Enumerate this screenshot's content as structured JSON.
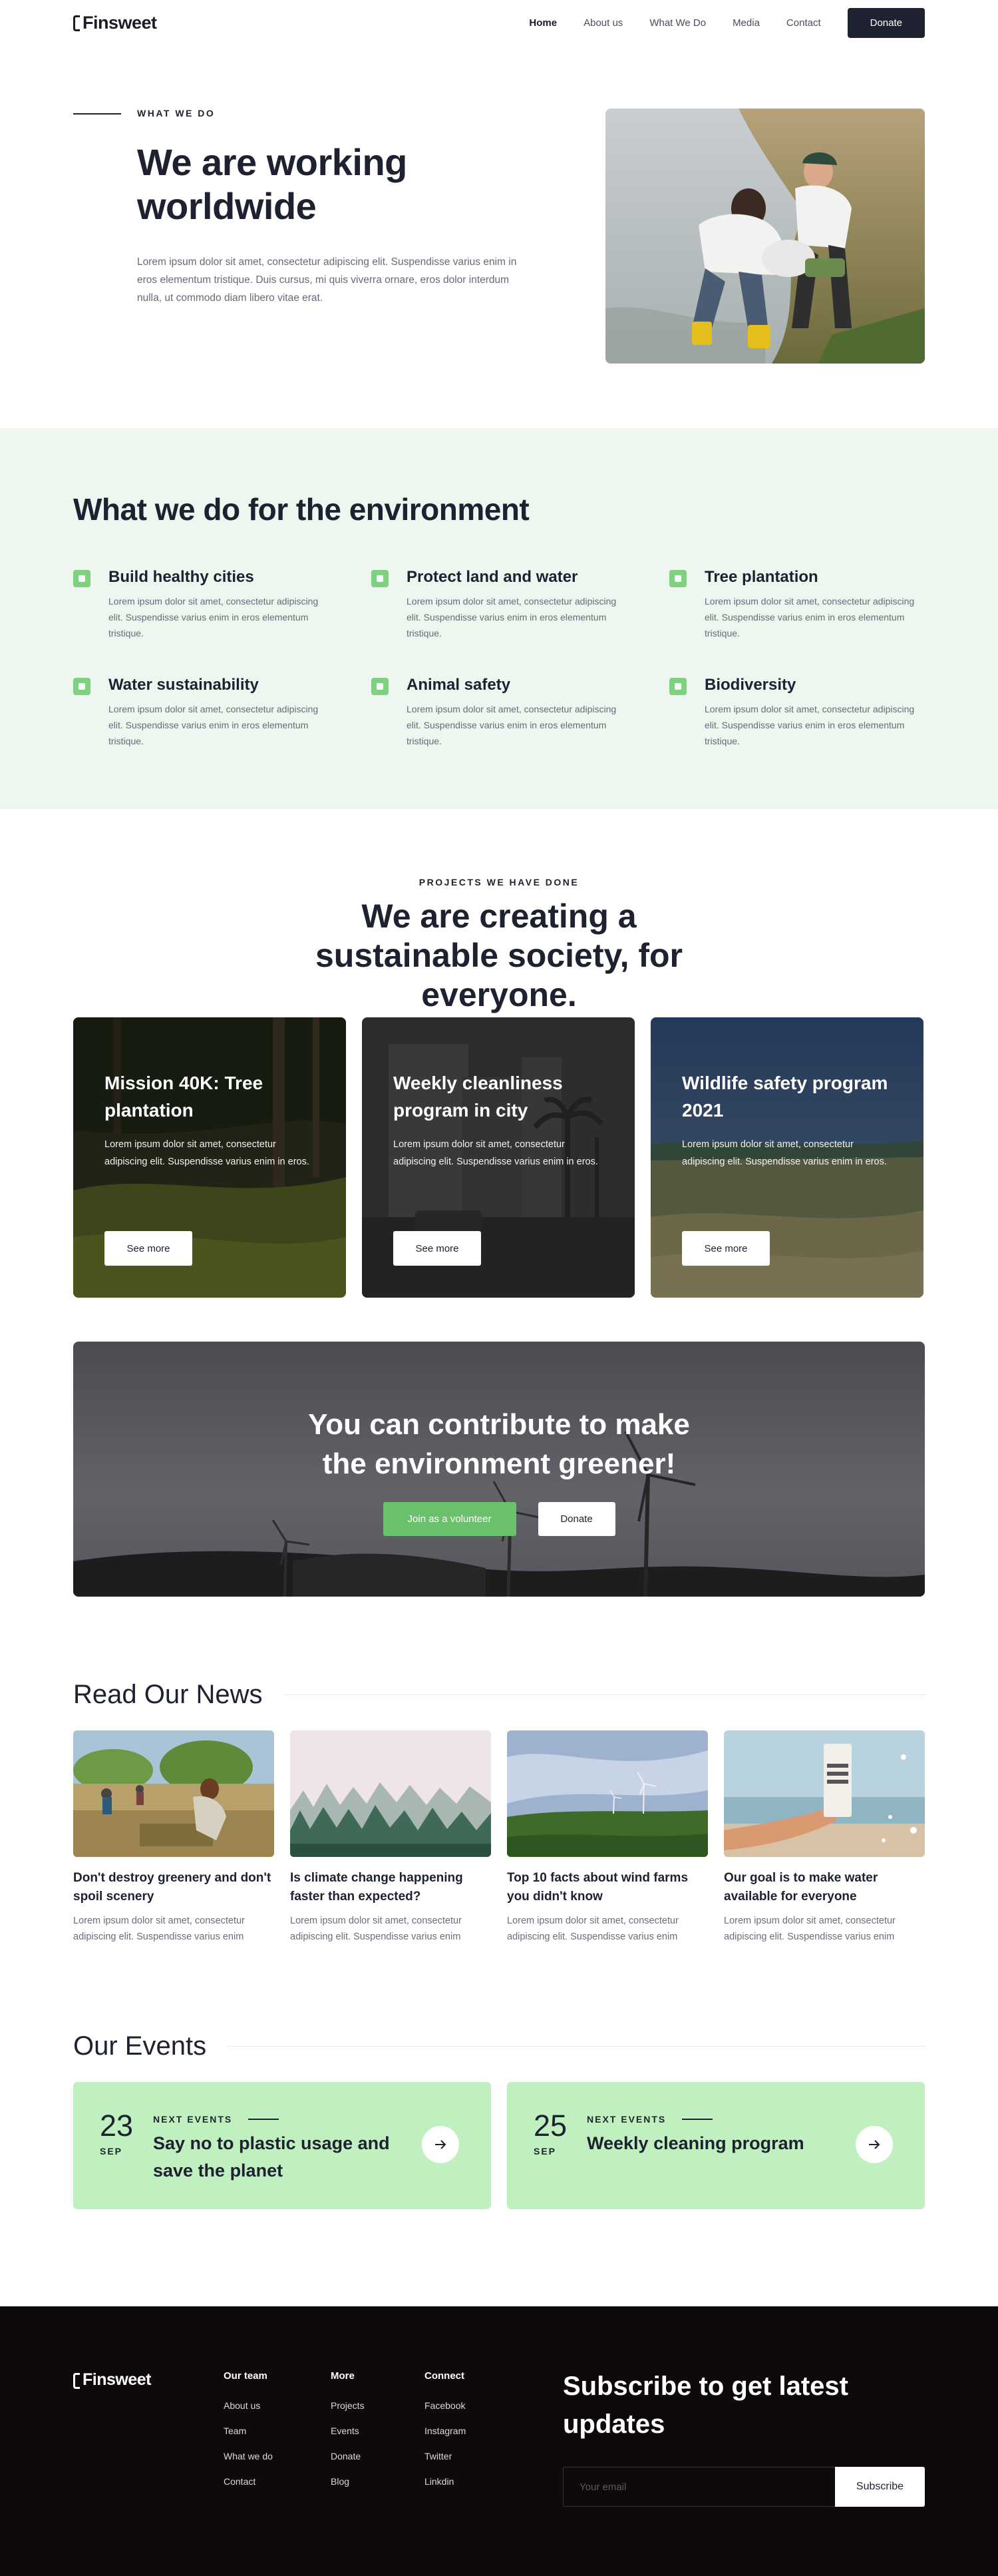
{
  "nav": {
    "logo": "Finsweet",
    "links": [
      "Home",
      "About us",
      "What We Do",
      "Media",
      "Contact"
    ],
    "active_index": 0,
    "donate_label": "Donate"
  },
  "hero": {
    "eyebrow": "WHAT WE DO",
    "title": "We are working worldwide",
    "text": "Lorem ipsum dolor sit amet, consectetur adipiscing elit. Suspendisse varius enim in eros elementum tristique. Duis cursus, mi quis viverra ornare, eros dolor interdum nulla, ut commodo diam libero vitae erat."
  },
  "environment": {
    "title": "What we do for the environment",
    "items": [
      {
        "title": "Build healthy cities",
        "text": "Lorem ipsum dolor sit amet, consectetur adipiscing elit. Suspendisse varius enim in eros elementum tristique."
      },
      {
        "title": "Protect land and water",
        "text": "Lorem ipsum dolor sit amet, consectetur adipiscing elit. Suspendisse varius enim in eros elementum tristique."
      },
      {
        "title": "Tree plantation",
        "text": "Lorem ipsum dolor sit amet, consectetur adipiscing elit. Suspendisse varius enim in eros elementum tristique."
      },
      {
        "title": "Water sustainability",
        "text": "Lorem ipsum dolor sit amet, consectetur adipiscing elit. Suspendisse varius enim in eros elementum tristique."
      },
      {
        "title": "Animal safety",
        "text": "Lorem ipsum dolor sit amet, consectetur adipiscing elit. Suspendisse varius enim in eros elementum tristique."
      },
      {
        "title": "Biodiversity",
        "text": "Lorem ipsum dolor sit amet, consectetur adipiscing elit. Suspendisse varius enim in eros elementum tristique."
      }
    ],
    "icon_color": "#7fd07f"
  },
  "projects": {
    "eyebrow": "PROJECTS WE HAVE DONE",
    "title": "We are creating a sustainable society, for everyone.",
    "cards": [
      {
        "title": "Mission 40K: Tree plantation",
        "text": "Lorem ipsum dolor sit amet, consectetur adipiscing elit. Suspendisse varius enim in eros.",
        "button": "See more"
      },
      {
        "title": "Weekly cleanliness program in city",
        "text": "Lorem ipsum dolor sit amet, consectetur adipiscing elit. Suspendisse varius enim in eros.",
        "button": "See more"
      },
      {
        "title": "Wildlife safety program 2021",
        "text": "Lorem ipsum dolor sit amet, consectetur adipiscing elit. Suspendisse varius enim in eros.",
        "button": "See more"
      }
    ]
  },
  "cta": {
    "title": "You can contribute to make the environment greener!",
    "volunteer_label": "Join as a volunteer",
    "donate_label": "Donate",
    "accent": "#6ac06b"
  },
  "news": {
    "title": "Read Our News",
    "items": [
      {
        "title": "Don't destroy greenery and don't spoil scenery",
        "text": "Lorem ipsum dolor sit amet, consectetur adipiscing elit. Suspendisse varius enim"
      },
      {
        "title": " Is climate change happening faster than expected?",
        "text": "Lorem ipsum dolor sit amet, consectetur adipiscing elit. Suspendisse varius enim"
      },
      {
        "title": "Top 10 facts about wind farms you didn't know",
        "text": "Lorem ipsum dolor sit amet, consectetur adipiscing elit. Suspendisse varius enim"
      },
      {
        "title": "Our goal is to make water available for everyone",
        "text": "Lorem ipsum dolor sit amet, consectetur adipiscing elit. Suspendisse varius enim"
      }
    ]
  },
  "events": {
    "title": "Our Events",
    "items": [
      {
        "day": "23",
        "month": "SEP",
        "label": "NEXT EVENTS",
        "title": "Say no to plastic usage and save the planet"
      },
      {
        "day": "25",
        "month": "SEP",
        "label": "NEXT EVENTS",
        "title": "Weekly cleaning program"
      }
    ],
    "card_color": "#c1f0c0"
  },
  "footer": {
    "logo": "Finsweet",
    "columns": [
      {
        "title": "Our team",
        "links": [
          "About us",
          "Team",
          "What we do",
          "Contact"
        ]
      },
      {
        "title": "More",
        "links": [
          "Projects",
          "Events",
          "Donate",
          "Blog"
        ]
      },
      {
        "title": "Connect",
        "links": [
          "Facebook",
          "Instagram",
          "Twitter",
          "Linkdin"
        ]
      }
    ],
    "subscribe_title": "Subscribe to get latest updates",
    "email_placeholder": "Your email",
    "subscribe_label": "Subscribe"
  }
}
